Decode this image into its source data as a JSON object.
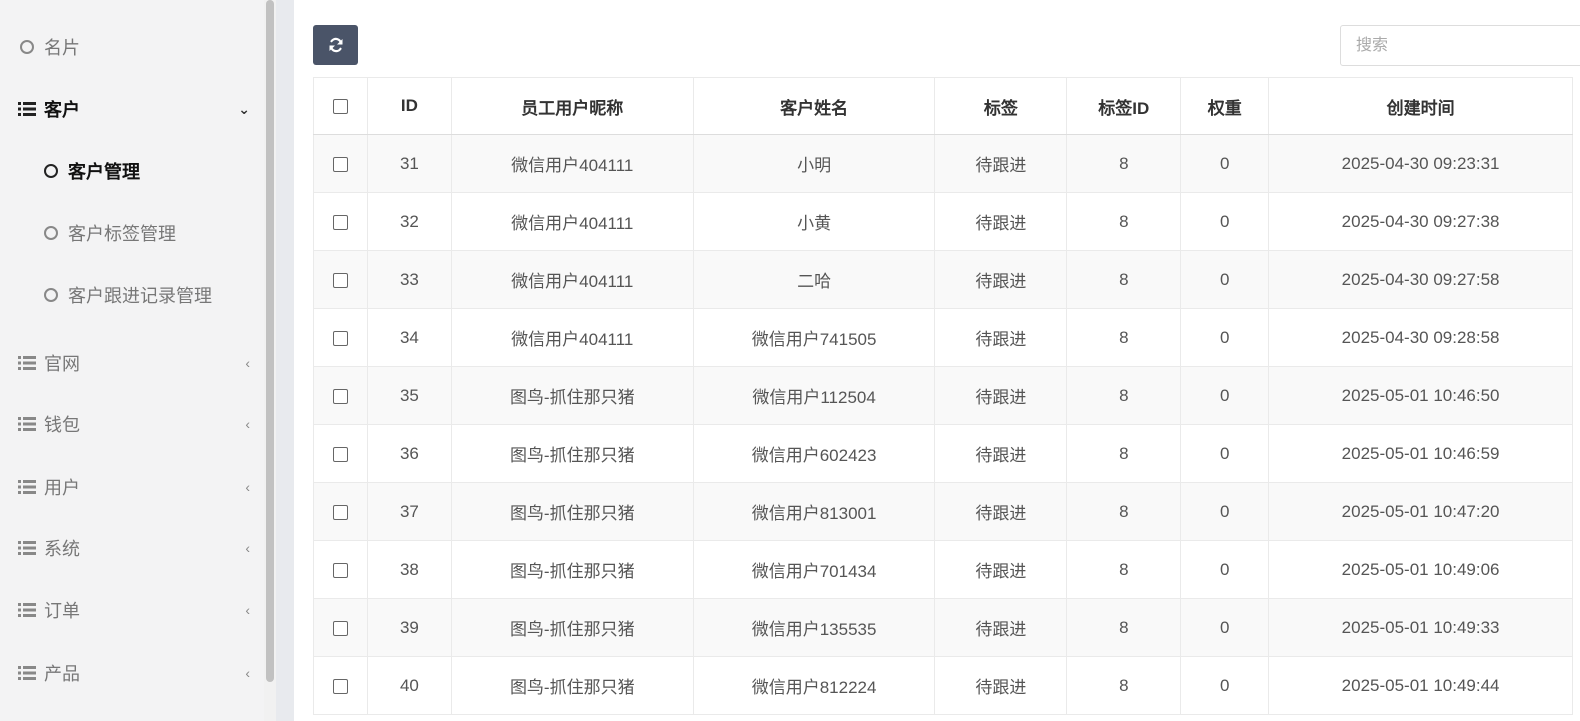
{
  "sidebar": {
    "items": [
      {
        "label": "名片",
        "icon": "circle-icon",
        "kind": "sub"
      },
      {
        "label": "客户",
        "icon": "list-icon",
        "kind": "group",
        "expanded": true
      },
      {
        "label": "客户管理",
        "icon": "circle-icon",
        "kind": "sub",
        "active": true
      },
      {
        "label": "客户标签管理",
        "icon": "circle-icon",
        "kind": "sub"
      },
      {
        "label": "客户跟进记录管理",
        "icon": "circle-icon",
        "kind": "sub"
      },
      {
        "label": "官网",
        "icon": "list-icon",
        "kind": "group"
      },
      {
        "label": "钱包",
        "icon": "list-icon",
        "kind": "group"
      },
      {
        "label": "用户",
        "icon": "list-icon",
        "kind": "group"
      },
      {
        "label": "系统",
        "icon": "list-icon",
        "kind": "group"
      },
      {
        "label": "订单",
        "icon": "list-icon",
        "kind": "group"
      },
      {
        "label": "产品",
        "icon": "list-icon",
        "kind": "group"
      }
    ]
  },
  "toolbar": {
    "refresh_icon": "refresh-icon",
    "search_placeholder": "搜索"
  },
  "table": {
    "headers": [
      "ID",
      "员工用户昵称",
      "客户姓名",
      "标签",
      "标签ID",
      "权重",
      "创建时间"
    ],
    "rows": [
      [
        "31",
        "微信用户404111",
        "小明",
        "待跟进",
        "8",
        "0",
        "2025-04-30 09:23:31"
      ],
      [
        "32",
        "微信用户404111",
        "小黄",
        "待跟进",
        "8",
        "0",
        "2025-04-30 09:27:38"
      ],
      [
        "33",
        "微信用户404111",
        "二哈",
        "待跟进",
        "8",
        "0",
        "2025-04-30 09:27:58"
      ],
      [
        "34",
        "微信用户404111",
        "微信用户741505",
        "待跟进",
        "8",
        "0",
        "2025-04-30 09:28:58"
      ],
      [
        "35",
        "图鸟-抓住那只猪",
        "微信用户112504",
        "待跟进",
        "8",
        "0",
        "2025-05-01 10:46:50"
      ],
      [
        "36",
        "图鸟-抓住那只猪",
        "微信用户602423",
        "待跟进",
        "8",
        "0",
        "2025-05-01 10:46:59"
      ],
      [
        "37",
        "图鸟-抓住那只猪",
        "微信用户813001",
        "待跟进",
        "8",
        "0",
        "2025-05-01 10:47:20"
      ],
      [
        "38",
        "图鸟-抓住那只猪",
        "微信用户701434",
        "待跟进",
        "8",
        "0",
        "2025-05-01 10:49:06"
      ],
      [
        "39",
        "图鸟-抓住那只猪",
        "微信用户135535",
        "待跟进",
        "8",
        "0",
        "2025-05-01 10:49:33"
      ],
      [
        "40",
        "图鸟-抓住那只猪",
        "微信用户812224",
        "待跟进",
        "8",
        "0",
        "2025-05-01 10:49:44"
      ]
    ]
  },
  "colors": {
    "sidebar_bg": "#f3f3f4",
    "button_bg": "#4a5468",
    "stripe": "#f9f9f9"
  }
}
